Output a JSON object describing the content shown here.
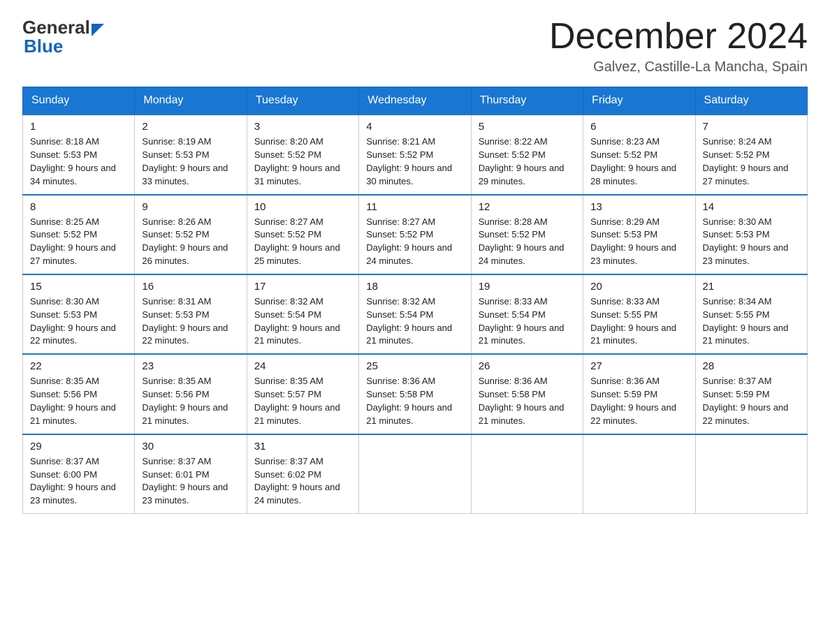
{
  "logo": {
    "general": "General",
    "blue": "Blue"
  },
  "title": "December 2024",
  "subtitle": "Galvez, Castille-La Mancha, Spain",
  "weekdays": [
    "Sunday",
    "Monday",
    "Tuesday",
    "Wednesday",
    "Thursday",
    "Friday",
    "Saturday"
  ],
  "weeks": [
    [
      {
        "day": "1",
        "sunrise": "8:18 AM",
        "sunset": "5:53 PM",
        "daylight": "9 hours and 34 minutes."
      },
      {
        "day": "2",
        "sunrise": "8:19 AM",
        "sunset": "5:53 PM",
        "daylight": "9 hours and 33 minutes."
      },
      {
        "day": "3",
        "sunrise": "8:20 AM",
        "sunset": "5:52 PM",
        "daylight": "9 hours and 31 minutes."
      },
      {
        "day": "4",
        "sunrise": "8:21 AM",
        "sunset": "5:52 PM",
        "daylight": "9 hours and 30 minutes."
      },
      {
        "day": "5",
        "sunrise": "8:22 AM",
        "sunset": "5:52 PM",
        "daylight": "9 hours and 29 minutes."
      },
      {
        "day": "6",
        "sunrise": "8:23 AM",
        "sunset": "5:52 PM",
        "daylight": "9 hours and 28 minutes."
      },
      {
        "day": "7",
        "sunrise": "8:24 AM",
        "sunset": "5:52 PM",
        "daylight": "9 hours and 27 minutes."
      }
    ],
    [
      {
        "day": "8",
        "sunrise": "8:25 AM",
        "sunset": "5:52 PM",
        "daylight": "9 hours and 27 minutes."
      },
      {
        "day": "9",
        "sunrise": "8:26 AM",
        "sunset": "5:52 PM",
        "daylight": "9 hours and 26 minutes."
      },
      {
        "day": "10",
        "sunrise": "8:27 AM",
        "sunset": "5:52 PM",
        "daylight": "9 hours and 25 minutes."
      },
      {
        "day": "11",
        "sunrise": "8:27 AM",
        "sunset": "5:52 PM",
        "daylight": "9 hours and 24 minutes."
      },
      {
        "day": "12",
        "sunrise": "8:28 AM",
        "sunset": "5:52 PM",
        "daylight": "9 hours and 24 minutes."
      },
      {
        "day": "13",
        "sunrise": "8:29 AM",
        "sunset": "5:53 PM",
        "daylight": "9 hours and 23 minutes."
      },
      {
        "day": "14",
        "sunrise": "8:30 AM",
        "sunset": "5:53 PM",
        "daylight": "9 hours and 23 minutes."
      }
    ],
    [
      {
        "day": "15",
        "sunrise": "8:30 AM",
        "sunset": "5:53 PM",
        "daylight": "9 hours and 22 minutes."
      },
      {
        "day": "16",
        "sunrise": "8:31 AM",
        "sunset": "5:53 PM",
        "daylight": "9 hours and 22 minutes."
      },
      {
        "day": "17",
        "sunrise": "8:32 AM",
        "sunset": "5:54 PM",
        "daylight": "9 hours and 21 minutes."
      },
      {
        "day": "18",
        "sunrise": "8:32 AM",
        "sunset": "5:54 PM",
        "daylight": "9 hours and 21 minutes."
      },
      {
        "day": "19",
        "sunrise": "8:33 AM",
        "sunset": "5:54 PM",
        "daylight": "9 hours and 21 minutes."
      },
      {
        "day": "20",
        "sunrise": "8:33 AM",
        "sunset": "5:55 PM",
        "daylight": "9 hours and 21 minutes."
      },
      {
        "day": "21",
        "sunrise": "8:34 AM",
        "sunset": "5:55 PM",
        "daylight": "9 hours and 21 minutes."
      }
    ],
    [
      {
        "day": "22",
        "sunrise": "8:35 AM",
        "sunset": "5:56 PM",
        "daylight": "9 hours and 21 minutes."
      },
      {
        "day": "23",
        "sunrise": "8:35 AM",
        "sunset": "5:56 PM",
        "daylight": "9 hours and 21 minutes."
      },
      {
        "day": "24",
        "sunrise": "8:35 AM",
        "sunset": "5:57 PM",
        "daylight": "9 hours and 21 minutes."
      },
      {
        "day": "25",
        "sunrise": "8:36 AM",
        "sunset": "5:58 PM",
        "daylight": "9 hours and 21 minutes."
      },
      {
        "day": "26",
        "sunrise": "8:36 AM",
        "sunset": "5:58 PM",
        "daylight": "9 hours and 21 minutes."
      },
      {
        "day": "27",
        "sunrise": "8:36 AM",
        "sunset": "5:59 PM",
        "daylight": "9 hours and 22 minutes."
      },
      {
        "day": "28",
        "sunrise": "8:37 AM",
        "sunset": "5:59 PM",
        "daylight": "9 hours and 22 minutes."
      }
    ],
    [
      {
        "day": "29",
        "sunrise": "8:37 AM",
        "sunset": "6:00 PM",
        "daylight": "9 hours and 23 minutes."
      },
      {
        "day": "30",
        "sunrise": "8:37 AM",
        "sunset": "6:01 PM",
        "daylight": "9 hours and 23 minutes."
      },
      {
        "day": "31",
        "sunrise": "8:37 AM",
        "sunset": "6:02 PM",
        "daylight": "9 hours and 24 minutes."
      },
      null,
      null,
      null,
      null
    ]
  ]
}
